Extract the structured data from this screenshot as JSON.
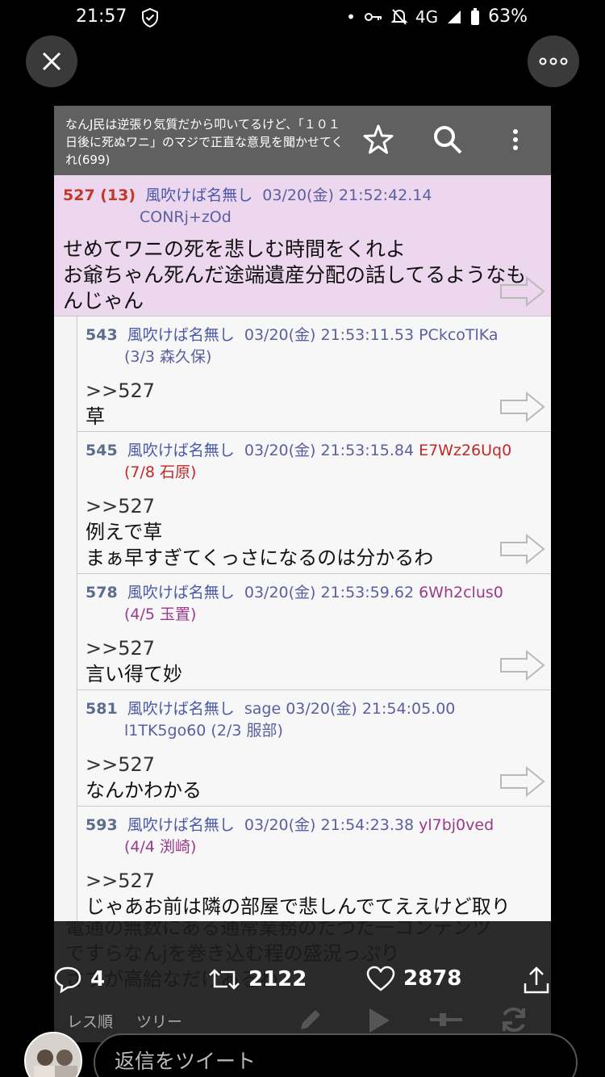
{
  "status": {
    "time": "21:57",
    "network": "4G",
    "battery": "63%"
  },
  "thread": {
    "title": "なんJ民は逆張り気質だから叩いてるけど、「１０１日後に死ぬワニ」のマジで正直な意見を聞かせてくれ(699)"
  },
  "posts": [
    {
      "num": "527 (13)",
      "name": "風吹けば名無し",
      "date": "03/20(金) 21:52:42.14",
      "id": "",
      "sub": "CONRj+zOd",
      "lines": [
        "せめてワニの死を悲しむ時間をくれよ",
        "お爺ちゃん死んだ途端遺産分配の話してるようなも",
        "んじゃん"
      ]
    },
    {
      "num": "543",
      "name": "風吹けば名無し",
      "date": "03/20(金) 21:53:11.53",
      "id": "PCkcoTlKa",
      "sub": "(3/3 森久保)",
      "lines": [
        ">>527",
        "草"
      ]
    },
    {
      "num": "545",
      "name": "風吹けば名無し",
      "date": "03/20(金) 21:53:15.84",
      "id": "E7Wz26Uq0",
      "sub": "(7/8 石原)",
      "lines": [
        ">>527",
        "例えで草",
        "まぁ早すぎてくっさになるのは分かるわ"
      ]
    },
    {
      "num": "578",
      "name": "風吹けば名無し",
      "date": "03/20(金) 21:53:59.62",
      "id": "6Wh2clus0",
      "sub": "(4/5 玉置)",
      "lines": [
        ">>527",
        "言い得て妙"
      ]
    },
    {
      "num": "581",
      "name": "風吹けば名無し",
      "date": "sage 03/20(金) 21:54:05.00",
      "id": "",
      "sub": "l1TK5go60 (2/3 服部)",
      "lines": [
        ">>527",
        "なんかわかる"
      ]
    },
    {
      "num": "593",
      "name": "風吹けば名無し",
      "date": "03/20(金) 21:54:23.38",
      "id": "yl7bj0ved",
      "sub": "(4/4 渕崎)",
      "lines": [
        ">>527",
        "じゃあお前は隣の部屋で悲しんでてええけど取り"
      ]
    }
  ],
  "caption": {
    "lines": [
      "電通の無数にある通常業務のたつた一コンテンツ",
      "ですらなんjを巻き込む程の盛況っぷり",
      "さすが高給なだけあるわ"
    ]
  },
  "tabs": {
    "order_label": "レス順",
    "tree_label": "ツリー"
  },
  "tweet_actions": {
    "replies": "4",
    "retweets": "2122",
    "likes": "2878"
  },
  "reply": {
    "placeholder": "返信をツイート"
  },
  "colors": {
    "main_post_bg": "#ecd7ee",
    "header_bg": "#606060",
    "name_color": "#4a58a8"
  }
}
